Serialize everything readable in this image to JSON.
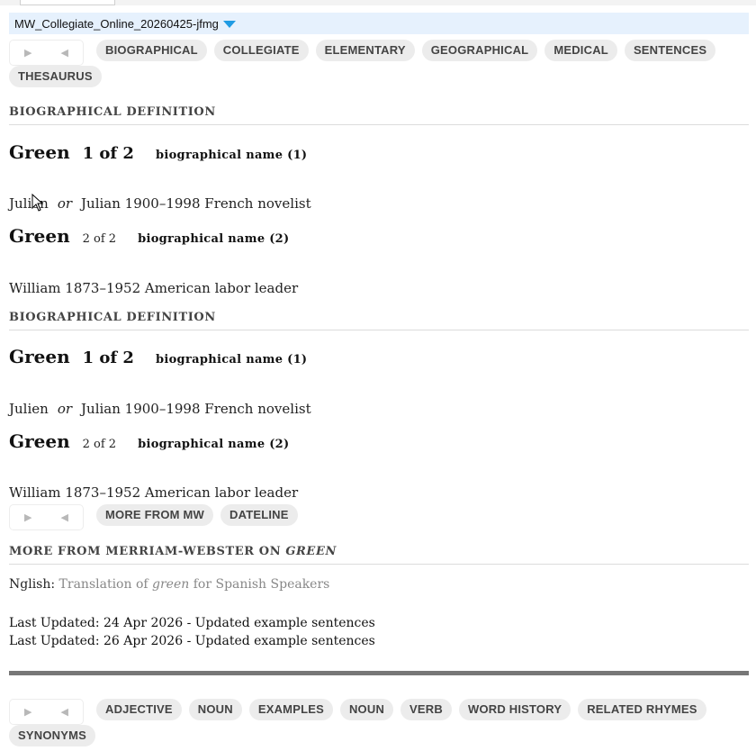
{
  "window": {
    "title": "MW_Collegiate_Online_20260425-jfmg"
  },
  "nav": {
    "forward": "▶",
    "back": "◀"
  },
  "tabs_top": [
    "BIOGRAPHICAL",
    "COLLEGIATE",
    "ELEMENTARY",
    "GEOGRAPHICAL",
    "MEDICAL",
    "SENTENCES",
    "THESAURUS"
  ],
  "sections": [
    {
      "heading": "BIOGRAPHICAL DEFINITION",
      "entries": [
        {
          "headword": "Green",
          "homograph": "1 of 2",
          "pos": "biographical name (1)",
          "definition": {
            "first": "Julien",
            "or": "or",
            "second": "Julian",
            "rest": "1900–1998 French novelist"
          }
        },
        {
          "headword": "Green",
          "homograph": "2 of 2",
          "pos": "biographical name (2)",
          "definition": {
            "text": "William 1873–1952 American labor leader"
          }
        }
      ]
    },
    {
      "heading": "BIOGRAPHICAL DEFINITION",
      "entries": [
        {
          "headword": "Green",
          "homograph": "1 of 2",
          "pos": "biographical name (1)",
          "definition": {
            "first": "Julien",
            "or": "or",
            "second": "Julian",
            "rest": "1900–1998 French novelist"
          }
        },
        {
          "headword": "Green",
          "homograph": "2 of 2",
          "pos": "biographical name (2)",
          "definition": {
            "text": "William 1873–1952 American labor leader"
          }
        }
      ]
    }
  ],
  "tabs_mid": [
    "MORE FROM MW",
    "DATELINE"
  ],
  "more": {
    "heading_prefix": "MORE FROM MERRIAM-WEBSTER ON",
    "heading_word": "GREEN",
    "nglish_label": "Nglish:",
    "nglish_link_pre": "Translation of",
    "nglish_link_word": "green",
    "nglish_link_post": "for Spanish Speakers"
  },
  "updates": [
    "Last Updated: 24 Apr 2026 - Updated example sentences",
    "Last Updated: 26 Apr 2026 - Updated example sentences"
  ],
  "tabs_bottom": [
    "ADJECTIVE",
    "NOUN",
    "EXAMPLES",
    "NOUN",
    "VERB",
    "WORD HISTORY",
    "RELATED RHYMES",
    "SYNONYMS"
  ],
  "colors": {
    "accent": "#1f9be3",
    "title_bg": "#e6f1fd",
    "pill_bg": "#ececec"
  }
}
